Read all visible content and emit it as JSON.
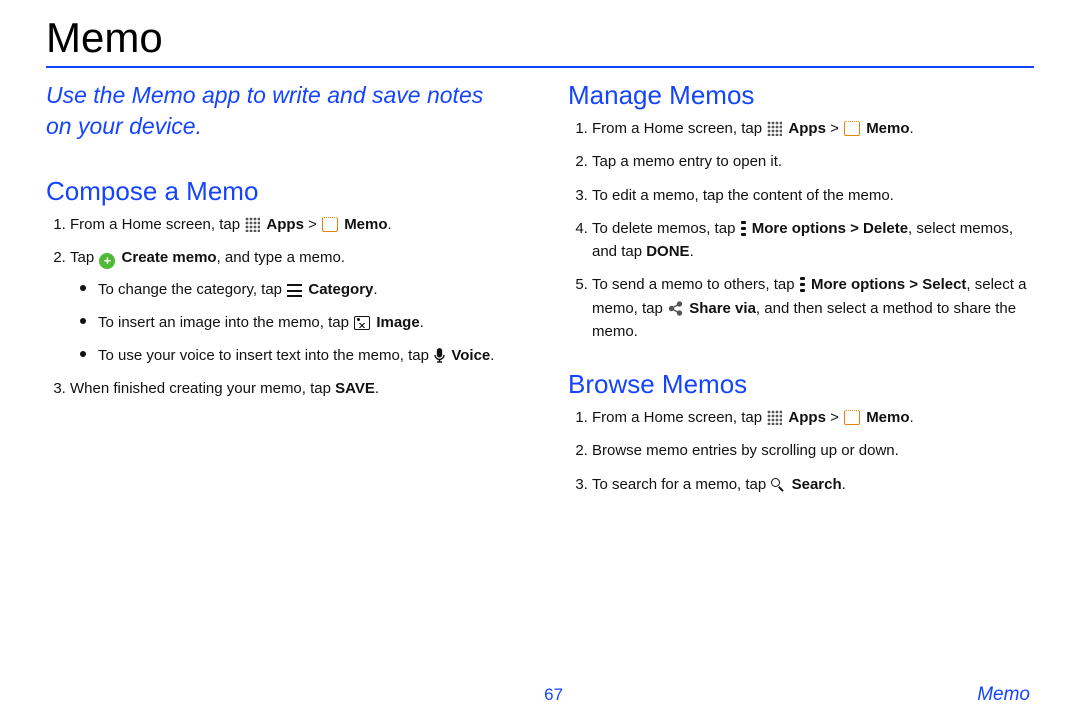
{
  "title": "Memo",
  "intro": "Use the Memo app to write and save notes on your device.",
  "sections": {
    "compose": {
      "heading": "Compose a Memo",
      "step1_a": "From a Home screen, tap ",
      "apps": "Apps",
      "gt": " > ",
      "memo": "Memo",
      "step2_a": "Tap ",
      "create": "Create memo",
      "step2_b": ", and type a memo.",
      "sub1_a": "To change the category, tap ",
      "category": "Category",
      "sub2_a": "To insert an image into the memo, tap ",
      "image": "Image",
      "sub3_a": "To use your voice to insert text into the memo, tap ",
      "voice": "Voice",
      "step3_a": "When finished creating your memo, tap ",
      "save": "SAVE"
    },
    "manage": {
      "heading": "Manage Memos",
      "s2": "Tap a memo entry to open it.",
      "s3": "To edit a memo, tap the content of the memo.",
      "s4_a": "To delete memos, tap ",
      "more": "More options",
      "s4_b": " > Delete",
      "s4_c": ", select memos, and tap ",
      "done": "DONE",
      "s5_a": "To send a memo to others, tap ",
      "s5_b": " > Select",
      "s5_c": ", select a memo, tap ",
      "share": "Share via",
      "s5_d": ", and then select a method to share the memo."
    },
    "browse": {
      "heading": "Browse Memos",
      "s2": "Browse memo entries by scrolling up or down.",
      "s3_a": "To search for a memo, tap ",
      "search": "Search"
    }
  },
  "footer": {
    "page": "67",
    "section": "Memo"
  }
}
